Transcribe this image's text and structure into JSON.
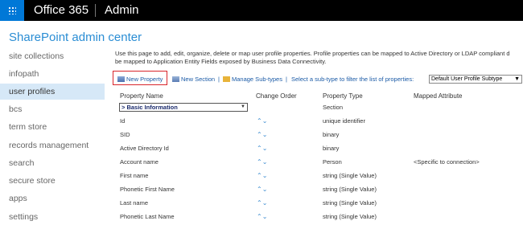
{
  "topbar": {
    "brand": "Office 365",
    "app": "Admin"
  },
  "page_title": "SharePoint admin center",
  "sidebar": {
    "items": [
      {
        "label": "site collections",
        "active": false
      },
      {
        "label": "infopath",
        "active": false
      },
      {
        "label": "user profiles",
        "active": true
      },
      {
        "label": "bcs",
        "active": false
      },
      {
        "label": "term store",
        "active": false
      },
      {
        "label": "records management",
        "active": false
      },
      {
        "label": "search",
        "active": false
      },
      {
        "label": "secure store",
        "active": false
      },
      {
        "label": "apps",
        "active": false
      },
      {
        "label": "settings",
        "active": false
      }
    ]
  },
  "description": {
    "line1": "Use this page to add, edit, organize, delete or map user profile properties. Profile properties can be mapped to Active Directory or LDAP compliant d",
    "line2": "be mapped to Application Entity Fields exposed by Business Data Connectivity."
  },
  "toolbar": {
    "new_property": "New Property",
    "new_section": "New Section",
    "sep1": "|",
    "manage_subtypes": "Manage Sub-types",
    "sep2": "|",
    "select_subtype": "Select a sub-type to filter the list of properties:",
    "subtype_value": "Default User Profile Subtype"
  },
  "table": {
    "headers": {
      "name": "Property Name",
      "order": "Change Order",
      "type": "Property Type",
      "mapped": "Mapped Attribute"
    },
    "section": {
      "label": "> Basic Information",
      "type": "Section"
    },
    "rows": [
      {
        "name": "Id",
        "type": "unique identifier",
        "mapped": ""
      },
      {
        "name": "SID",
        "type": "binary",
        "mapped": ""
      },
      {
        "name": "Active Directory Id",
        "type": "binary",
        "mapped": ""
      },
      {
        "name": "Account name",
        "type": "Person",
        "mapped": "<Specific to connection>"
      },
      {
        "name": "First name",
        "type": "string (Single Value)",
        "mapped": ""
      },
      {
        "name": "Phonetic First Name",
        "type": "string (Single Value)",
        "mapped": ""
      },
      {
        "name": "Last name",
        "type": "string (Single Value)",
        "mapped": ""
      },
      {
        "name": "Phonetic Last Name",
        "type": "string (Single Value)",
        "mapped": ""
      }
    ]
  },
  "icons": {
    "waffle": "app-launcher-icon",
    "new_property": "new-property-icon",
    "new_section": "new-section-icon",
    "manage": "folder-icon",
    "order": "chevron-up-down-icon"
  },
  "colors": {
    "accent": "#0078d7",
    "title": "#2a8dd4",
    "highlight": "#d9252b",
    "nav_active": "#d6e8f7"
  }
}
